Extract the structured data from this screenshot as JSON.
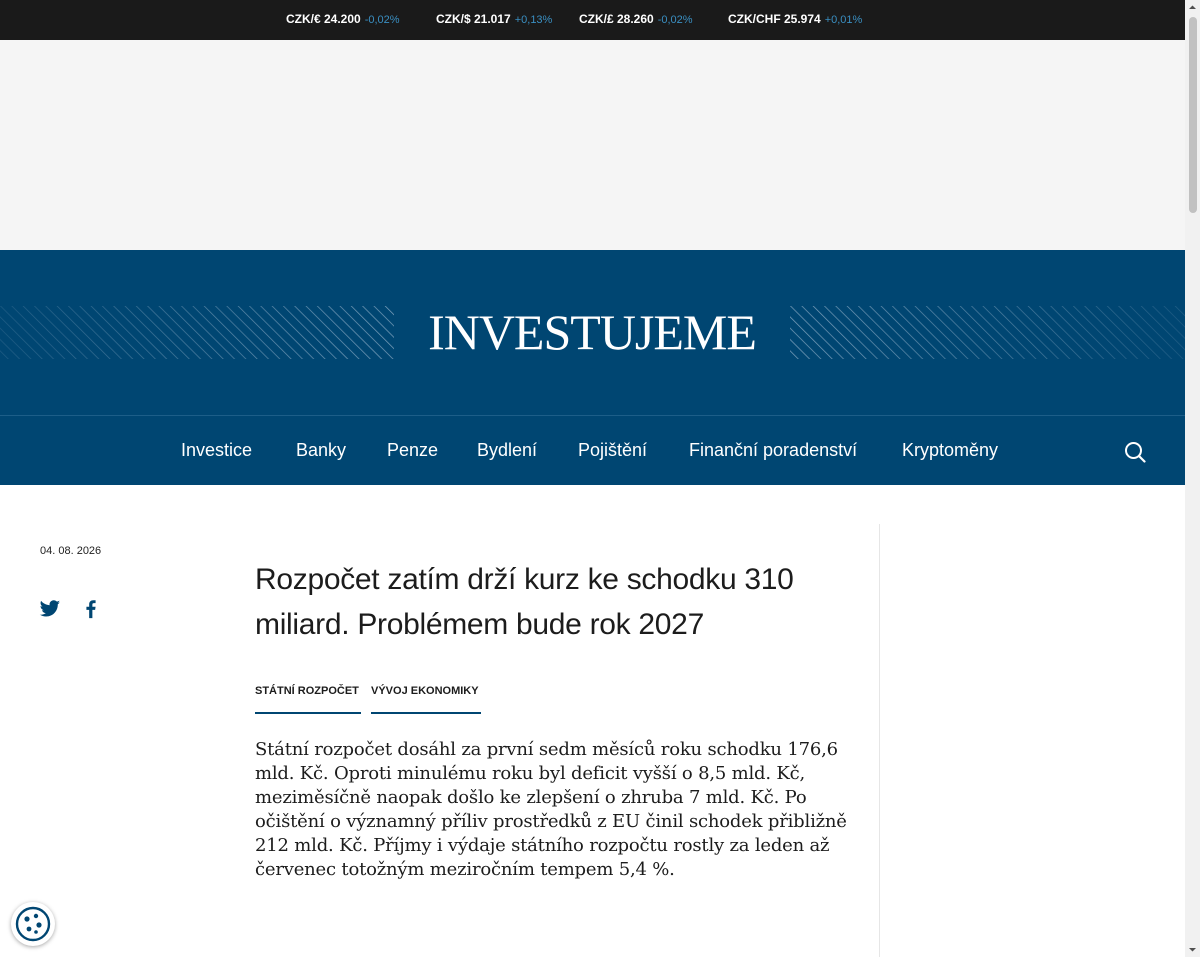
{
  "ticker": [
    {
      "pair": "CZK/€ 24.200",
      "change": "-0,02%"
    },
    {
      "pair": "CZK/$ 21.017",
      "change": "+0,13%"
    },
    {
      "pair": "CZK/£ 28.260",
      "change": "-0,02%"
    },
    {
      "pair": "CZK/CHF 25.974",
      "change": "+0,01%"
    }
  ],
  "brand": {
    "logo": "INVESTUJEME"
  },
  "nav": {
    "items": [
      "Investice",
      "Banky",
      "Penze",
      "Bydlení",
      "Pojištění",
      "Finanční poradenství",
      "Kryptoměny"
    ],
    "search_icon": "search-icon"
  },
  "article": {
    "date": "04. 08. 2026",
    "share": {
      "twitter_icon": "twitter-icon",
      "facebook_icon": "facebook-icon"
    },
    "title": "Rozpočet zatím drží kurz ke schodku 310 miliard. Problémem bude rok 2027",
    "tags": [
      "STÁTNÍ ROZPOČET",
      "VÝVOJ EKONOMIKY"
    ],
    "perex": "Státní rozpočet dosáhl za první sedm měsíců roku schodku 176,6 mld. Kč. Oproti minulému roku byl deficit vyšší o 8,5 mld. Kč, meziměsíčně naopak došlo ke zlepšení o zhruba 7 mld. Kč. Po očištění o významný příliv prostředků z EU činil schodek přibližně 212 mld. Kč. Příjmy i výdaje státního rozpočtu rostly za leden až červenec totožným meziročním tempem 5,4 %."
  },
  "cookie": {
    "icon": "cookie-settings-icon"
  },
  "colors": {
    "brand_blue": "#004672",
    "ticker_bg": "#1a1a1a",
    "change": "#3a8fc2"
  }
}
